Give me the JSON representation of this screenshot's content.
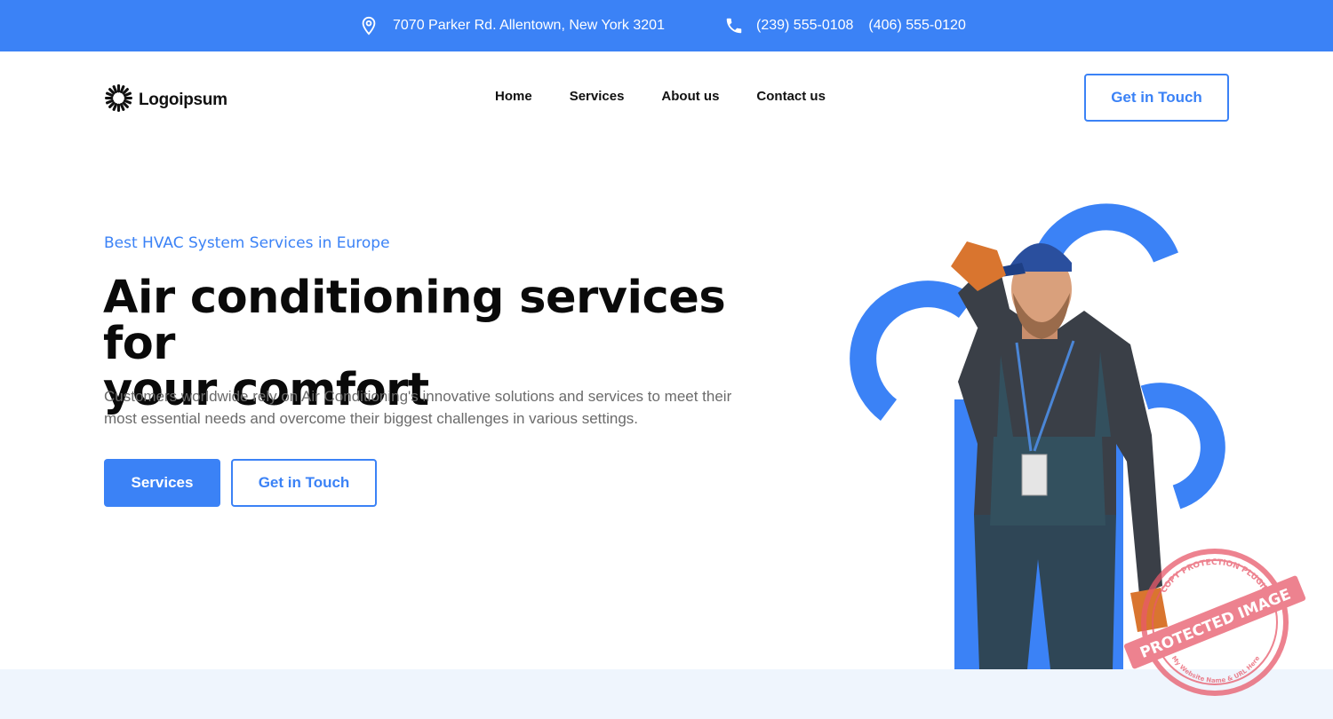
{
  "topbar": {
    "address": "7070 Parker Rd. Allentown, New York 3201",
    "phone_1": "(239) 555-0108",
    "phone_2": "(406) 555-0120",
    "icons": [
      "location-pin-icon",
      "phone-icon"
    ]
  },
  "header": {
    "logo_text": "Logoipsum",
    "nav": [
      "Home",
      "Services",
      "About us",
      "Contact us"
    ],
    "cta_label": "Get in Touch"
  },
  "hero": {
    "eyebrow": "Best HVAC System Services in Europe",
    "title_line_1": "Air conditioning services for",
    "title_line_2": "your comfort",
    "description_line_1": "Customers worldwide rely on Air Conditioning's innovative solutions and services to meet their",
    "description_line_2": "most essential needs and overcome their biggest challenges in various settings.",
    "primary_button": "Services",
    "secondary_button": "Get in Touch"
  },
  "watermark": {
    "arc_text": "COPY PROTECTION PLUGIN",
    "band_text": "PROTECTED IMAGE",
    "bottom_text": "My Website Name & URL Here"
  },
  "colors": {
    "brand_blue": "#3b82f6",
    "text_dark": "#0a0a0a",
    "text_muted": "#6b6b6b",
    "bottom_strip": "#eff5fd",
    "stamp_red": "#e8596a"
  }
}
